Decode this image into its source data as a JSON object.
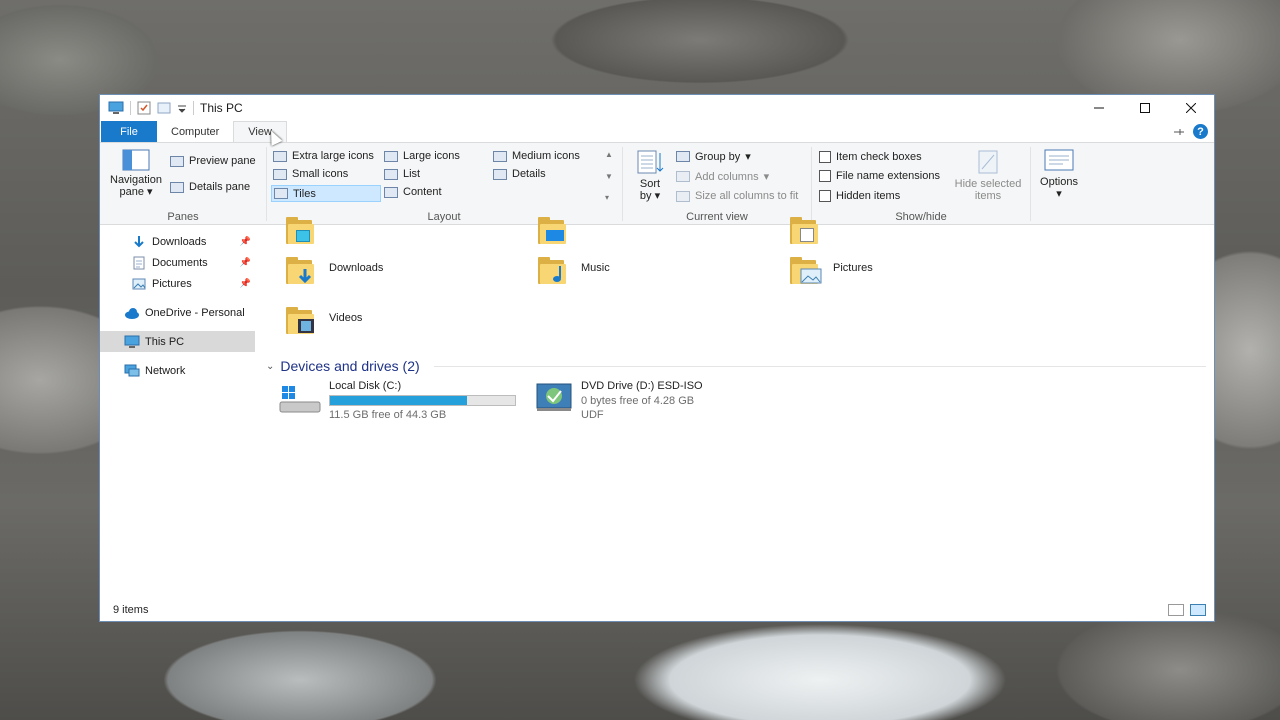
{
  "window": {
    "title": "This PC"
  },
  "tabs": [
    {
      "label": "File"
    },
    {
      "label": "Computer"
    },
    {
      "label": "View"
    }
  ],
  "ribbon": {
    "panes": {
      "group_label": "Panes",
      "navigation_pane_line1": "Navigation",
      "navigation_pane_line2": "pane",
      "preview_pane": "Preview pane",
      "details_pane": "Details pane"
    },
    "layout": {
      "group_label": "Layout",
      "options": [
        "Extra large icons",
        "Large icons",
        "Medium icons",
        "Small icons",
        "List",
        "Details",
        "Tiles",
        "Content"
      ],
      "selected": "Tiles"
    },
    "current_view": {
      "group_label": "Current view",
      "sort_line1": "Sort",
      "sort_line2": "by",
      "group_by": "Group by",
      "add_columns": "Add columns",
      "size_all_columns": "Size all columns to fit"
    },
    "show_hide": {
      "group_label": "Show/hide",
      "item_check_boxes": "Item check boxes",
      "file_name_extensions": "File name extensions",
      "hidden_items": "Hidden items",
      "hide_selected_line1": "Hide selected",
      "hide_selected_line2": "items"
    },
    "options": {
      "label": "Options"
    }
  },
  "nav": {
    "items": [
      {
        "label": "Downloads",
        "pinned": true
      },
      {
        "label": "Documents",
        "pinned": true
      },
      {
        "label": "Pictures",
        "pinned": true
      },
      {
        "label": "OneDrive - Personal"
      },
      {
        "label": "This PC",
        "selected": true
      },
      {
        "label": "Network"
      }
    ]
  },
  "folders": [
    {
      "label": "Downloads"
    },
    {
      "label": "Music"
    },
    {
      "label": "Pictures"
    },
    {
      "label": "Videos"
    }
  ],
  "devices": {
    "header": "Devices and drives (2)",
    "drives": [
      {
        "name": "Local Disk (C:)",
        "free": "11.5 GB free of 44.3 GB",
        "used_fraction": 0.74
      },
      {
        "name": "DVD Drive (D:) ESD-ISO",
        "free": "0 bytes free of 4.28 GB",
        "fs": "UDF"
      }
    ]
  },
  "status": {
    "items": "9 items"
  },
  "colors": {
    "accent": "#1979ca",
    "folder": "#f7d673",
    "progress": "#26a0da",
    "section": "#1e3287"
  }
}
